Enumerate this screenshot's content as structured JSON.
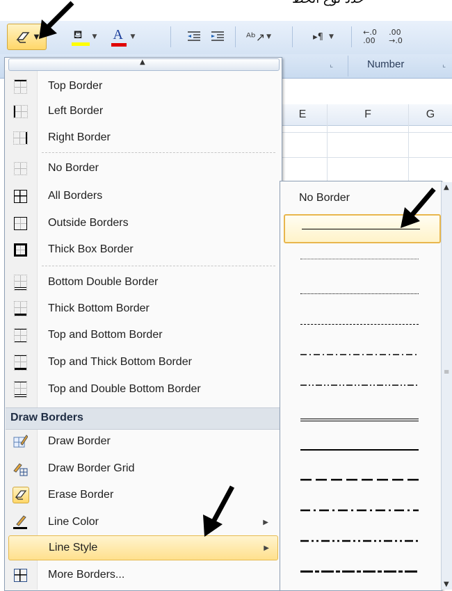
{
  "top_text": "حدد نوع الخط",
  "ribbon": {
    "number_label": "Number",
    "number_format_left": "←.0 .00",
    "number_format_right": ".00 →.0",
    "indent_glyph": "⇤⇥"
  },
  "sheet": {
    "col_e": "E",
    "col_f": "F",
    "col_g": "G"
  },
  "menu": {
    "items": [
      {
        "label": "Top Border",
        "icon": "border-top-icon"
      },
      {
        "label": "Left Border",
        "icon": "border-left-icon"
      },
      {
        "label": "Right Border",
        "icon": "border-right-icon"
      },
      {
        "label": "No Border",
        "icon": "border-none-icon"
      },
      {
        "label": "All Borders",
        "icon": "border-all-icon"
      },
      {
        "label": "Outside Borders",
        "icon": "border-outside-icon"
      },
      {
        "label": "Thick Box Border",
        "icon": "border-thick-box-icon"
      },
      {
        "label": "Bottom Double Border",
        "icon": "border-bottom-double-icon"
      },
      {
        "label": "Thick Bottom Border",
        "icon": "border-thick-bottom-icon"
      },
      {
        "label": "Top and Bottom Border",
        "icon": "border-top-bottom-icon"
      },
      {
        "label": "Top and Thick Bottom Border",
        "icon": "border-top-thick-bottom-icon"
      },
      {
        "label": "Top and Double Bottom Border",
        "icon": "border-top-double-bottom-icon"
      }
    ],
    "draw_header": "Draw Borders",
    "draw_items": [
      {
        "label": "Draw Border",
        "icon": "draw-border-icon"
      },
      {
        "label": "Draw Border Grid",
        "icon": "draw-border-grid-icon"
      },
      {
        "label": "Erase Border",
        "icon": "eraser-icon"
      },
      {
        "label": "Line Color",
        "icon": "line-color-icon"
      },
      {
        "label": "Line Style",
        "icon": "line-style-icon"
      },
      {
        "label": "More Borders...",
        "icon": "more-borders-icon"
      }
    ],
    "highlight": "Line Style"
  },
  "submenu": {
    "title": "No Border",
    "selected_index": 0,
    "styles": [
      "thin",
      "hair",
      "dotted",
      "dashed",
      "dash-dot",
      "dash-dot-dot",
      "double",
      "medium",
      "medium-dashed",
      "medium-dash-dot",
      "medium-dash-dot-dot",
      "slant-dash-dot"
    ]
  },
  "colors": {
    "highlight_bg": "#ffe08d",
    "highlight_border": "#e6b94c",
    "ribbon_bg": "#d5e3f4",
    "font_color_red": "#e00000",
    "fill_yellow": "#ffff00"
  }
}
